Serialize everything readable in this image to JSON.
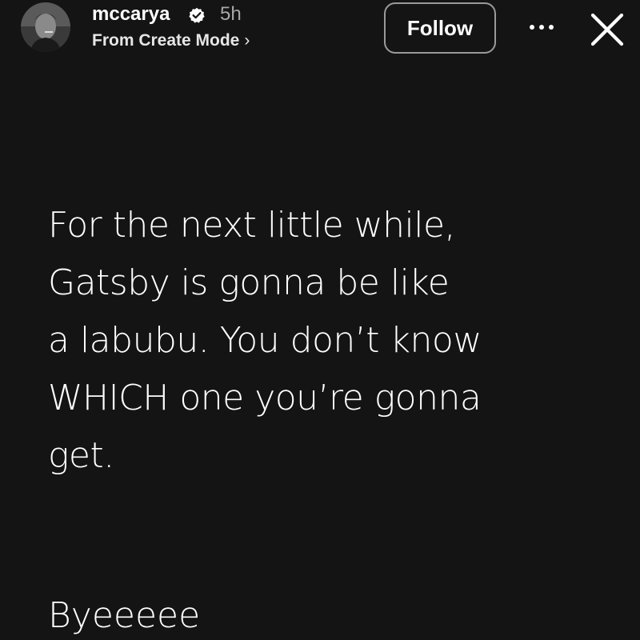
{
  "header": {
    "username": "mccarya",
    "verified_icon": "verified-badge-icon",
    "timestamp": "5h",
    "source": "From Create Mode",
    "source_chevron": "›",
    "follow_label": "Follow",
    "more_icon": "more-options-icon",
    "close_icon": "close-icon",
    "avatar_icon": "profile-avatar"
  },
  "post": {
    "lines": [
      "For the next little while,",
      "Gatsby is gonna be like",
      "a labubu. You don’t know",
      "WHICH one you’re gonna",
      "get."
    ],
    "signoff": "Byeeeee"
  },
  "colors": {
    "background": "#141414",
    "text": "#ffffff",
    "muted": "#a8a8a8",
    "button_border": "#9a9a9a"
  }
}
